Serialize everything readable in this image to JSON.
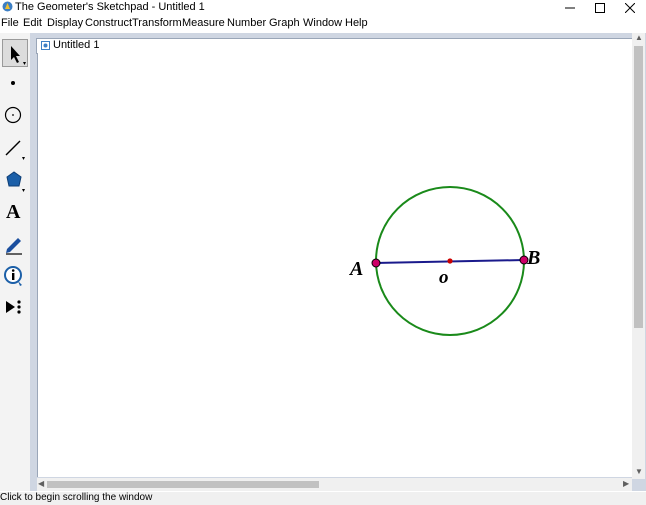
{
  "window": {
    "title": "The Geometer's Sketchpad - Untitled 1",
    "minimize_icon": "minimize-icon",
    "maximize_icon": "maximize-icon",
    "close_icon": "close-icon"
  },
  "menu": [
    "File",
    "Edit",
    "Display",
    "Construct",
    "Transform",
    "Measure",
    "Number",
    "Graph",
    "Window",
    "Help"
  ],
  "toolbox": [
    {
      "name": "selection-arrow-tool",
      "icon": "arrow-icon"
    },
    {
      "name": "point-tool",
      "icon": "point-icon"
    },
    {
      "name": "compass-tool",
      "icon": "circle-icon"
    },
    {
      "name": "straightedge-tool",
      "icon": "line-icon"
    },
    {
      "name": "polygon-tool",
      "icon": "polygon-icon"
    },
    {
      "name": "text-tool",
      "icon": "text-icon",
      "glyph": "A"
    },
    {
      "name": "marker-tool",
      "icon": "marker-icon"
    },
    {
      "name": "information-tool",
      "icon": "info-icon"
    },
    {
      "name": "custom-tool",
      "icon": "custom-tools-icon"
    }
  ],
  "document": {
    "title": "Untitled 1"
  },
  "sketch": {
    "circle_color": "#1a8a1a",
    "segment_color": "#1a1a8c",
    "point_color": "#cc0066",
    "center_point_color": "#cc0000",
    "labels": {
      "point_a": "A",
      "point_b": "B",
      "center": "o"
    }
  },
  "status": {
    "text": "Click to begin scrolling the window"
  }
}
